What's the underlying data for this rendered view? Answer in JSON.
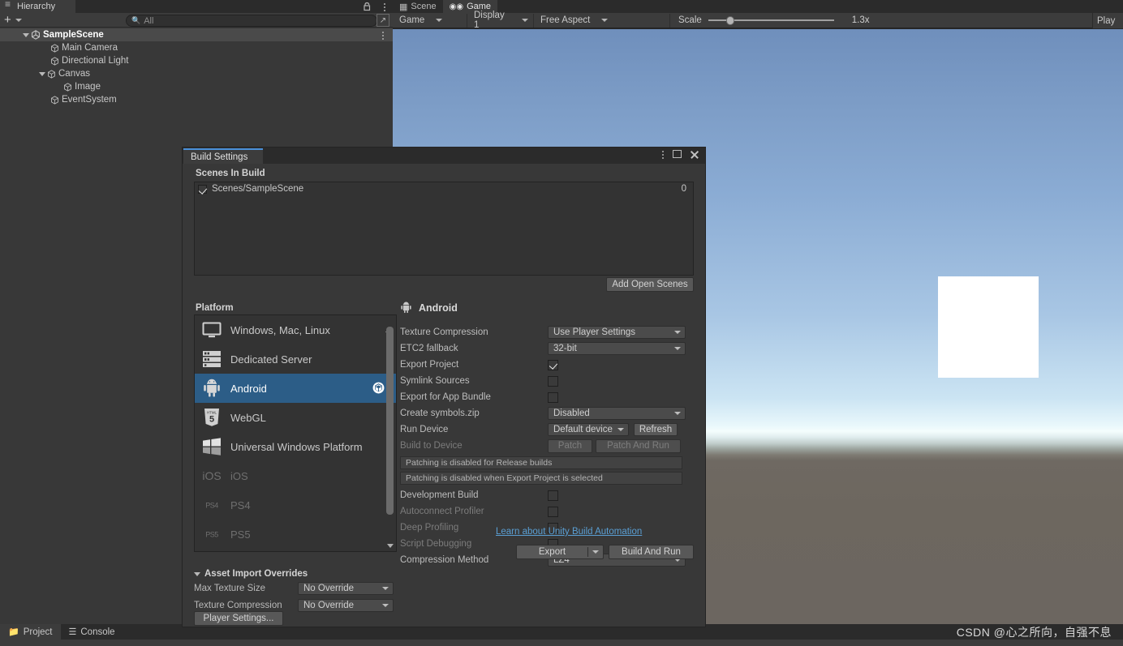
{
  "hierarchy": {
    "tab_label": "Hierarchy",
    "tab_icon": "list-icon",
    "lock_icon": "lock-icon",
    "kebab_icon": "kebab-menu-icon",
    "create_label": "+",
    "search_placeholder": "All",
    "search_icon": "search-icon",
    "expand_icon": "expand-window-icon",
    "tree": [
      {
        "label": "SampleScene",
        "depth": 0,
        "icon": "unity-scene-icon",
        "expanded": true,
        "selected": true
      },
      {
        "label": "Main Camera",
        "depth": 1,
        "icon": "gameobject-cube-icon",
        "expanded": null,
        "selected": false
      },
      {
        "label": "Directional Light",
        "depth": 1,
        "icon": "gameobject-cube-icon",
        "expanded": null,
        "selected": false
      },
      {
        "label": "Canvas",
        "depth": 1,
        "icon": "gameobject-cube-icon",
        "expanded": true,
        "selected": false
      },
      {
        "label": "Image",
        "depth": 2,
        "icon": "gameobject-cube-icon",
        "expanded": null,
        "selected": false
      },
      {
        "label": "EventSystem",
        "depth": 1,
        "icon": "gameobject-cube-icon",
        "expanded": null,
        "selected": false
      }
    ]
  },
  "gameview": {
    "tabs": [
      {
        "label": "Scene",
        "icon": "grid-icon",
        "active": false
      },
      {
        "label": "Game",
        "icon": "gamepad-icon",
        "active": true
      }
    ],
    "toolbar": {
      "target": "Game",
      "display": "Display 1",
      "aspect": "Free Aspect",
      "scale_label": "Scale",
      "scale_value": "1.3x",
      "play_label": "Play"
    }
  },
  "bottom": {
    "tabs": [
      {
        "label": "Project",
        "icon": "folder-icon",
        "active": true
      },
      {
        "label": "Console",
        "icon": "console-icon",
        "active": false
      }
    ],
    "watermark": "CSDN @心之所向，自强不息"
  },
  "build_settings": {
    "title": "Build Settings",
    "window_controls": {
      "kebab": "kebab-menu-icon",
      "maximize": "maximize-icon",
      "close": "close-icon"
    },
    "scenes_section": {
      "title": "Scenes In Build",
      "scenes": [
        {
          "name": "Scenes/SampleScene",
          "checked": true,
          "index": "0"
        }
      ],
      "add_open_scenes": "Add Open Scenes"
    },
    "platform_section": {
      "title": "Platform",
      "platforms": [
        {
          "label": "Windows, Mac, Linux",
          "icon": "monitor-icon",
          "selected": false,
          "disabled": false
        },
        {
          "label": "Dedicated Server",
          "icon": "server-icon",
          "selected": false,
          "disabled": false
        },
        {
          "label": "Android",
          "icon": "android-icon",
          "selected": true,
          "disabled": false,
          "badge": "unity-logo-icon"
        },
        {
          "label": "WebGL",
          "icon": "html5-icon",
          "selected": false,
          "disabled": false
        },
        {
          "label": "Universal Windows Platform",
          "icon": "windows-icon",
          "selected": false,
          "disabled": false
        },
        {
          "label": "iOS",
          "icon": "ios-icon",
          "selected": false,
          "disabled": true
        },
        {
          "label": "PS4",
          "icon": "ps4-icon",
          "selected": false,
          "disabled": true
        },
        {
          "label": "PS5",
          "icon": "ps5-icon",
          "selected": false,
          "disabled": true
        }
      ]
    },
    "asset_import_overrides": {
      "title": "Asset Import Overrides",
      "rows": [
        {
          "label": "Max Texture Size",
          "value": "No Override"
        },
        {
          "label": "Texture Compression",
          "value": "No Override"
        }
      ],
      "player_settings_button": "Player Settings..."
    },
    "android_panel": {
      "title": "Android",
      "icon": "android-icon",
      "texture_compression": {
        "label": "Texture Compression",
        "value": "Use Player Settings"
      },
      "etc2_fallback": {
        "label": "ETC2 fallback",
        "value": "32-bit"
      },
      "export_project": {
        "label": "Export Project",
        "checked": true
      },
      "symlink_sources": {
        "label": "Symlink Sources",
        "checked": false
      },
      "export_app_bundle": {
        "label": "Export for App Bundle",
        "checked": false
      },
      "create_symbols": {
        "label": "Create symbols.zip",
        "value": "Disabled"
      },
      "run_device": {
        "label": "Run Device",
        "value": "Default device",
        "refresh": "Refresh"
      },
      "build_to_device": {
        "label": "Build to Device",
        "patch": "Patch",
        "patch_and_run": "Patch And Run",
        "disabled": true
      },
      "help_messages": [
        "Patching is disabled for Release builds",
        "Patching is disabled when Export Project is selected"
      ],
      "development_build": {
        "label": "Development Build",
        "checked": false,
        "disabled": false
      },
      "autoconnect_profiler": {
        "label": "Autoconnect Profiler",
        "checked": false,
        "disabled": true
      },
      "deep_profiling": {
        "label": "Deep Profiling",
        "checked": false,
        "disabled": true
      },
      "script_debugging": {
        "label": "Script Debugging",
        "checked": false,
        "disabled": true
      },
      "compression_method": {
        "label": "Compression Method",
        "value": "LZ4"
      },
      "learn_link": "Learn about Unity Build Automation",
      "export_button": "Export",
      "build_and_run_button": "Build And Run"
    }
  },
  "colors": {
    "accent_blue": "#4a90d9",
    "selection_blue": "#2c5d87",
    "link_blue": "#5a9fd4",
    "panel_bg": "#383838",
    "field_bg": "#333333"
  }
}
